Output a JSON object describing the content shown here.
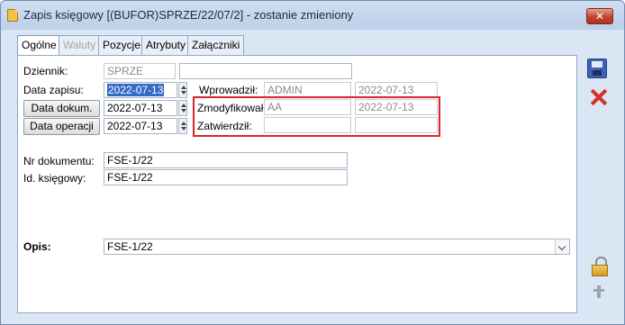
{
  "window": {
    "title": "Zapis księgowy [(BUFOR)SPRZE/22/07/2] - zostanie zmieniony",
    "close_label": "✕"
  },
  "tabs": [
    {
      "label": "Ogólne",
      "state": "active"
    },
    {
      "label": "Waluty",
      "state": "disabled"
    },
    {
      "label": "Pozycje",
      "state": "normal"
    },
    {
      "label": "Atrybuty",
      "state": "normal"
    },
    {
      "label": "Załączniki",
      "state": "normal"
    }
  ],
  "form": {
    "dziennik_label": "Dziennik:",
    "dziennik_value": "SPRZE",
    "dziennik_extra": "",
    "data_zapisu_label": "Data zapisu:",
    "data_zapisu_value": "2022-07-13",
    "data_dokum_button": "Data dokum.",
    "data_dokum_value": "2022-07-13",
    "data_operacji_button": "Data operacji",
    "data_operacji_value": "2022-07-13",
    "wprowadzil_label": "Wprowadził:",
    "wprowadzil_user": "ADMIN",
    "wprowadzil_date": "2022-07-13",
    "zmodyfikowal_label": "Zmodyfikował:",
    "zmodyfikowal_user": "AA",
    "zmodyfikowal_date": "2022-07-13",
    "zatwierdzil_label": "Zatwierdził:",
    "zatwierdzil_user": "",
    "zatwierdzil_date": "",
    "nr_dokumentu_label": "Nr dokumentu:",
    "nr_dokumentu_value": "FSE-1/22",
    "id_ksiegowy_label": "Id. księgowy:",
    "id_ksiegowy_value": "FSE-1/22",
    "opis_label": "Opis:",
    "opis_value": "FSE-1/22"
  },
  "colors": {
    "highlight_box": "#d9252b",
    "selection": "#3369c7"
  }
}
